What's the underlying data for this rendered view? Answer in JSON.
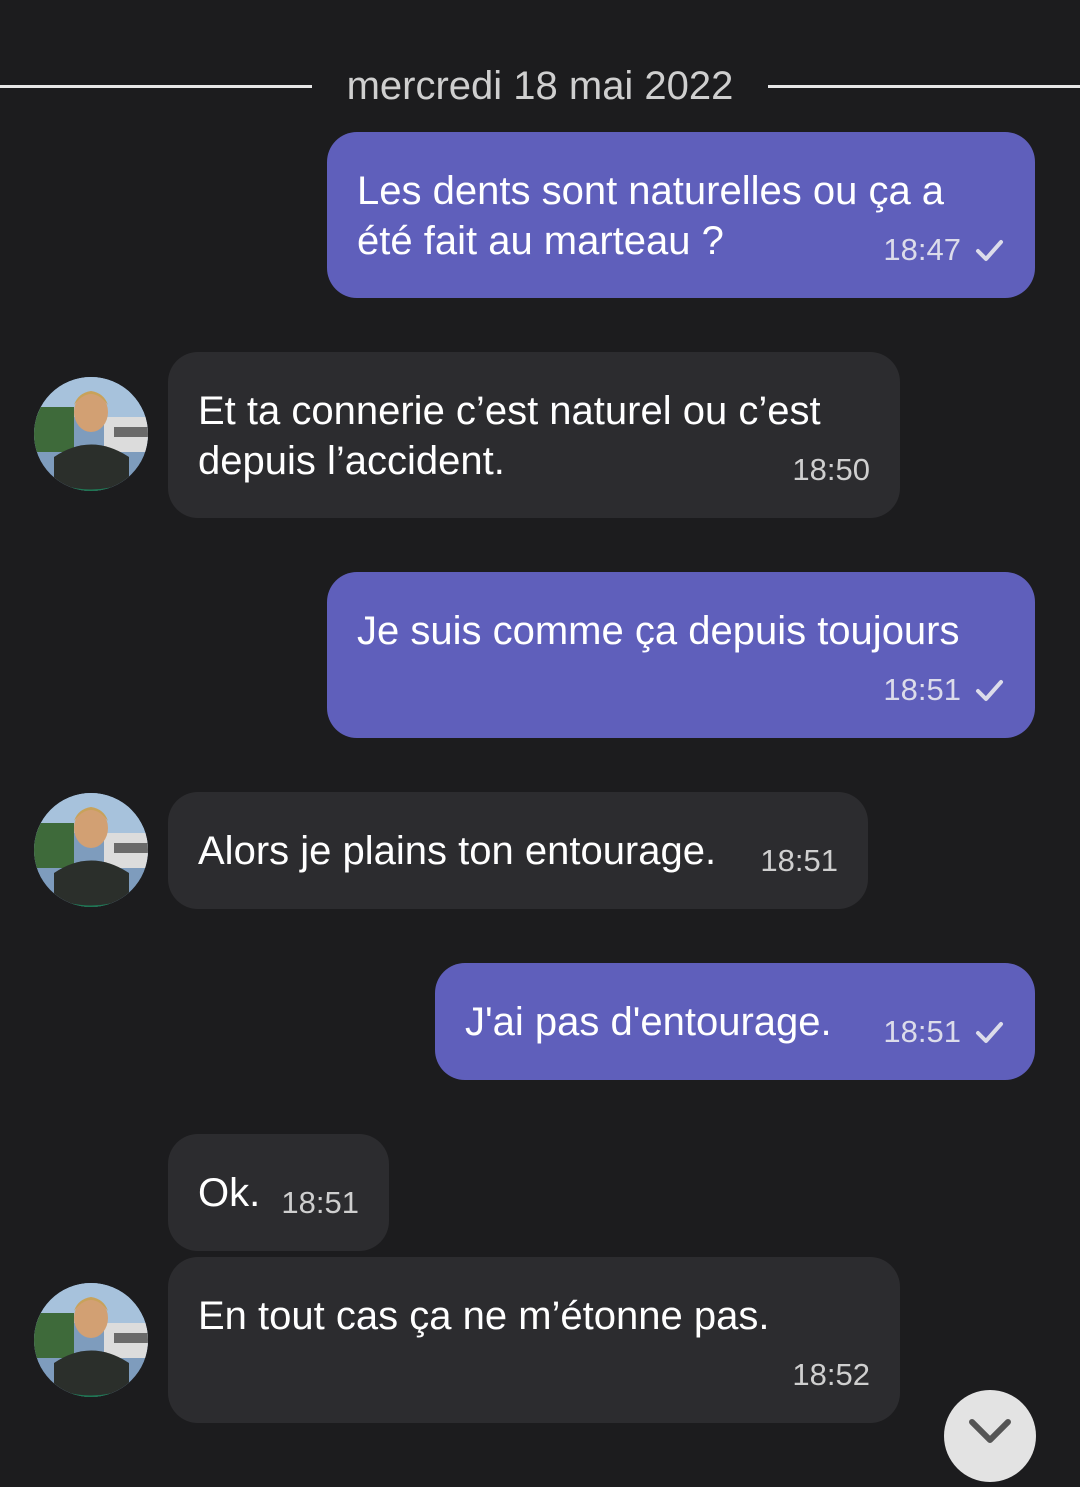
{
  "date_separator": "mercredi 18 mai 2022",
  "messages": [
    {
      "direction": "out",
      "text": "Les dents sont naturelles ou ça a\nété fait au marteau ?",
      "time": "18:47",
      "status": "sent-check-icon"
    },
    {
      "direction": "in",
      "text": "Et ta connerie c’est naturel ou c’est\ndepuis l’accident.",
      "time": "18:50",
      "avatar": true
    },
    {
      "direction": "out",
      "text": "Je suis comme ça depuis toujours",
      "time": "18:51",
      "status": "sent-check-icon"
    },
    {
      "direction": "in",
      "text": "Alors je plains ton entourage.",
      "time": "18:51",
      "avatar": true
    },
    {
      "direction": "out",
      "text": "J'ai pas d'entourage.",
      "time": "18:51",
      "status": "sent-check-icon"
    },
    {
      "direction": "in",
      "text": "Ok.",
      "time": "18:51",
      "avatar": false
    },
    {
      "direction": "in",
      "text": "En tout cas ça ne m’étonne pas.",
      "time": "18:52",
      "avatar": true
    }
  ],
  "scroll_button_icon": "chevron-down-icon",
  "colors": {
    "background": "#1c1c1e",
    "outgoing_bubble": "#5f5fbb",
    "incoming_bubble": "#2c2c2f"
  }
}
